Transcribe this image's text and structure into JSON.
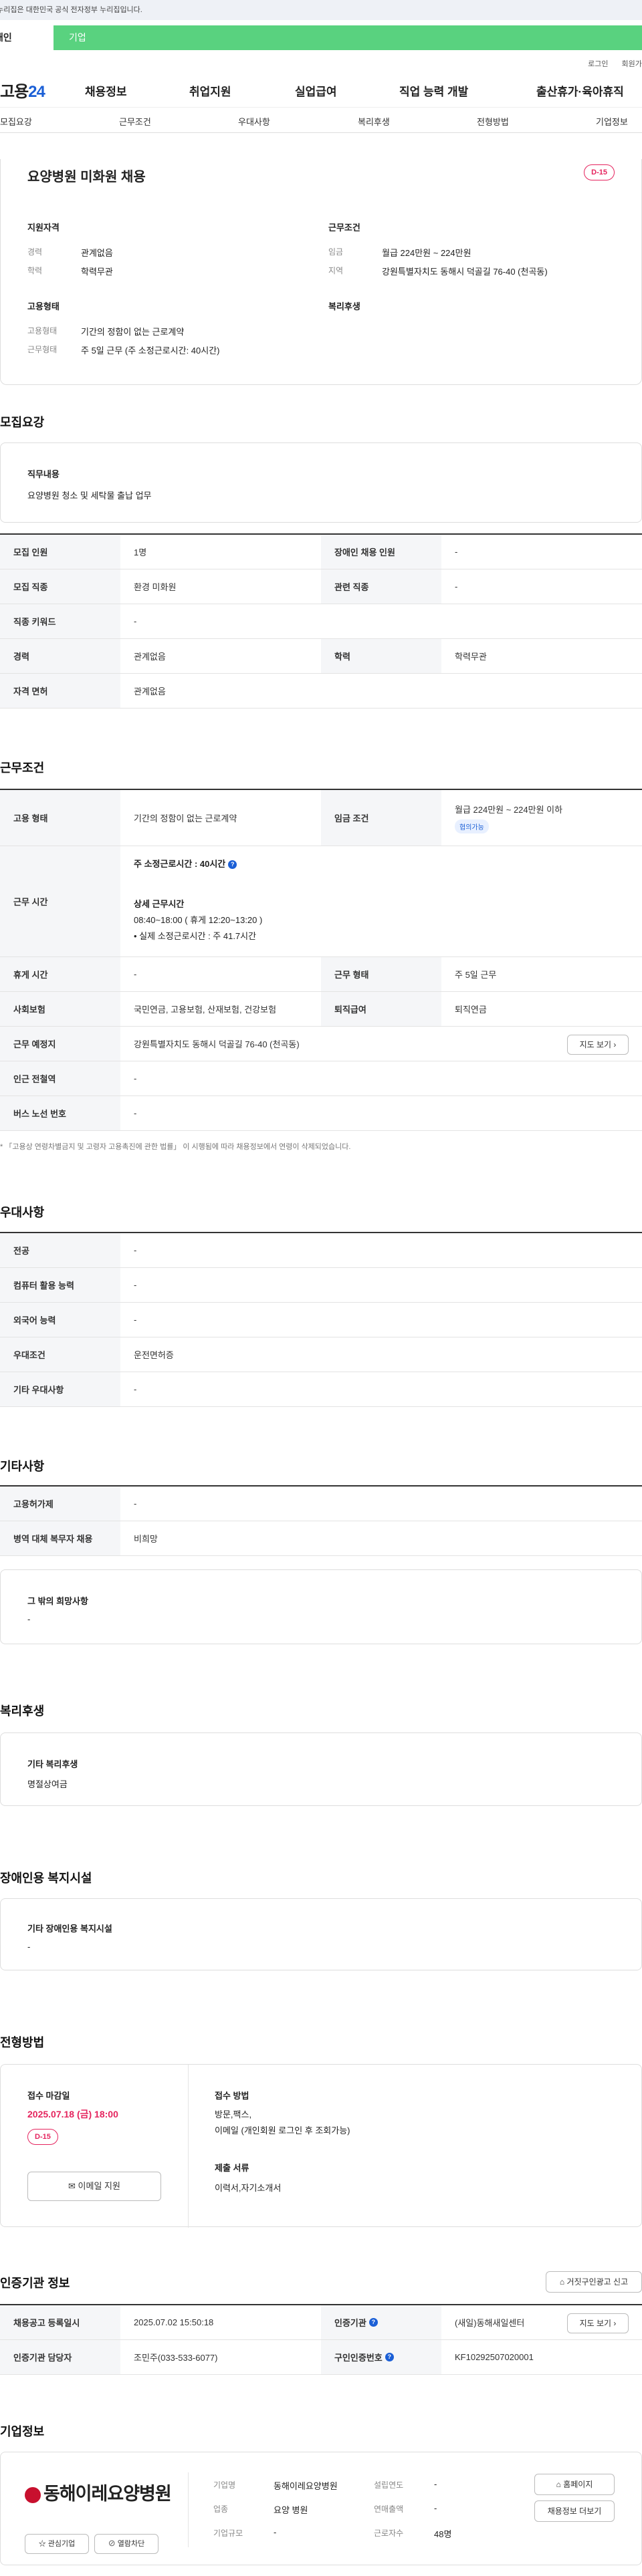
{
  "topbar": {
    "notice": "이 누리집은 대한민국 공식 전자정부 누리집입니다."
  },
  "tabs": {
    "first": "개인",
    "second": "기업"
  },
  "util": {
    "login": "로그인",
    "join": "회원가입"
  },
  "gnb": {
    "logo_a": "고용",
    "logo_b": "24",
    "items": [
      "채용정보",
      "취업지원",
      "실업급여",
      "직업 능력 개발",
      "출산휴가·육아휴직"
    ]
  },
  "subnav": [
    "모집요강",
    "근무조건",
    "우대사항",
    "복리후생",
    "전형방법",
    "기업정보"
  ],
  "summary": {
    "title": "요양병원 미화원 채용",
    "dday": "D-15",
    "qual": {
      "heading": "지원자격",
      "career_label": "경력",
      "career": "관계없음",
      "edu_label": "학력",
      "edu": "학력무관"
    },
    "cond": {
      "heading": "근무조건",
      "wage_label": "임금",
      "wage": "월급 224만원 ~ 224만원",
      "area_label": "지역",
      "area": "강원특별자치도 동해시 덕골길 76-40 (천곡동)"
    },
    "emp": {
      "heading": "고용형태",
      "type_label": "고용형태",
      "type": "기간의 정함이 없는 근로계약",
      "hours_label": "근무형태",
      "hours": "주 5일 근무 (주 소정근로시간: 40시간)"
    },
    "welfare": {
      "heading": "복리후생"
    }
  },
  "recruit": {
    "title": "모집요강",
    "duty_label": "직무내용",
    "duty": "요양병원 청소 및 세탁물 출납 업무",
    "r1": {
      "a": "모집 인원",
      "b": "1명",
      "c": "장애인 채용 인원",
      "d": "-"
    },
    "r2": {
      "a": "모집 직종",
      "b": "환경 미화원",
      "c": "관련 직종",
      "d": "-"
    },
    "r3": {
      "a": "직종 키워드",
      "b": "-"
    },
    "r4": {
      "a": "경력",
      "b": "관계없음",
      "c": "학력",
      "d": "학력무관"
    },
    "r5": {
      "a": "자격 면허",
      "b": "관계없음"
    }
  },
  "work": {
    "title": "근무조건",
    "r1": {
      "a": "고용 형태",
      "b": "기간의 정함이 없는 근로계약",
      "c": "임금 조건",
      "d": "월급 224만원 ~ 224만원 이하",
      "pill": "협의가능"
    },
    "r2": {
      "a": "근무 시간",
      "weekly": "주 소정근로시간 : 40시간",
      "detail_h": "상세 근무시간",
      "detail": "08:40~18:00 ( 휴게 12:20~13:20 )",
      "actual": "• 실제 소정근로시간 : 주 41.7시간"
    },
    "r3": {
      "a": "휴게 시간",
      "b": "-",
      "c": "근무 형태",
      "d": "주 5일 근무"
    },
    "r4": {
      "a": "사회보험",
      "b": "국민연금, 고용보험, 산재보험, 건강보험",
      "c": "퇴직급여",
      "d": "퇴직연금"
    },
    "r5": {
      "a": "근무 예정지",
      "b": "강원특별자치도 동해시 덕골길 76-40 (천곡동)",
      "btn": "지도 보기"
    },
    "r6": {
      "a": "인근 전철역",
      "b": "-"
    },
    "r7": {
      "a": "버스 노선 번호",
      "b": "-"
    },
    "note": "* 「고용상 연령차별금지 및 고령자 고용촉진에 관한 법률」 이 시행됨에 따라 채용정보에서 연령이 삭제되었습니다."
  },
  "pref": {
    "title": "우대사항",
    "rows": [
      {
        "a": "전공",
        "b": "-"
      },
      {
        "a": "컴퓨터 활용 능력",
        "b": "-"
      },
      {
        "a": "외국어 능력",
        "b": "-"
      },
      {
        "a": "우대조건",
        "b": "운전면허증"
      },
      {
        "a": "기타 우대사항",
        "b": "-"
      }
    ]
  },
  "etc": {
    "title": "기타사항",
    "rows": [
      {
        "a": "고용허가제",
        "b": "-"
      },
      {
        "a": "병역 대체 복무자 채용",
        "b": "비희망"
      }
    ],
    "wish_label": "그 밖의 희망사항",
    "wish": "-"
  },
  "welfare": {
    "title": "복리후생",
    "label": "기타 복리후생",
    "value": "명절상여금"
  },
  "disab": {
    "title": "장애인용 복지시설",
    "label": "기타 장애인용 복지시설",
    "value": "-"
  },
  "select": {
    "title": "전형방법",
    "deadline_label": "접수 마감일",
    "deadline": "2025.07.18 (금) 18:00",
    "dday": "D-15",
    "email_btn": "이메일 지원",
    "method_label": "접수 방법",
    "method1": "방문,팩스,",
    "method2": "이메일 (개인회원 로그인 후 조회가능)",
    "docs_label": "제출 서류",
    "docs": "이력서,자기소개서"
  },
  "cert": {
    "title": "인증기관 정보",
    "report_btn": "거짓구인광고 신고",
    "r1": {
      "a": "채용공고 등록일시",
      "b": "2025.07.02 15:50:18",
      "c": "인증기관",
      "d": "(새일)동해새일센터",
      "btn": "지도 보기"
    },
    "r2": {
      "a": "인증기관 담당자",
      "b": "조민주(033-533-6077)",
      "c": "구인인증번호",
      "d": "KF10292507020001"
    }
  },
  "company": {
    "title": "기업정보",
    "logo": "동해이레요양병원",
    "name_label": "기업명",
    "name": "동해이레요양병원",
    "year_label": "설립연도",
    "year": "-",
    "ind_label": "업종",
    "ind": "요양 병원",
    "sales_label": "연매출액",
    "sales": "-",
    "size_label": "기업규모",
    "size": "-",
    "emp_label": "근로자수",
    "emp": "48명",
    "home_btn": "홈페이지",
    "jobs_btn": "채용정보 더보기",
    "fav_btn": "관심기업",
    "block_btn": "열람차단"
  }
}
